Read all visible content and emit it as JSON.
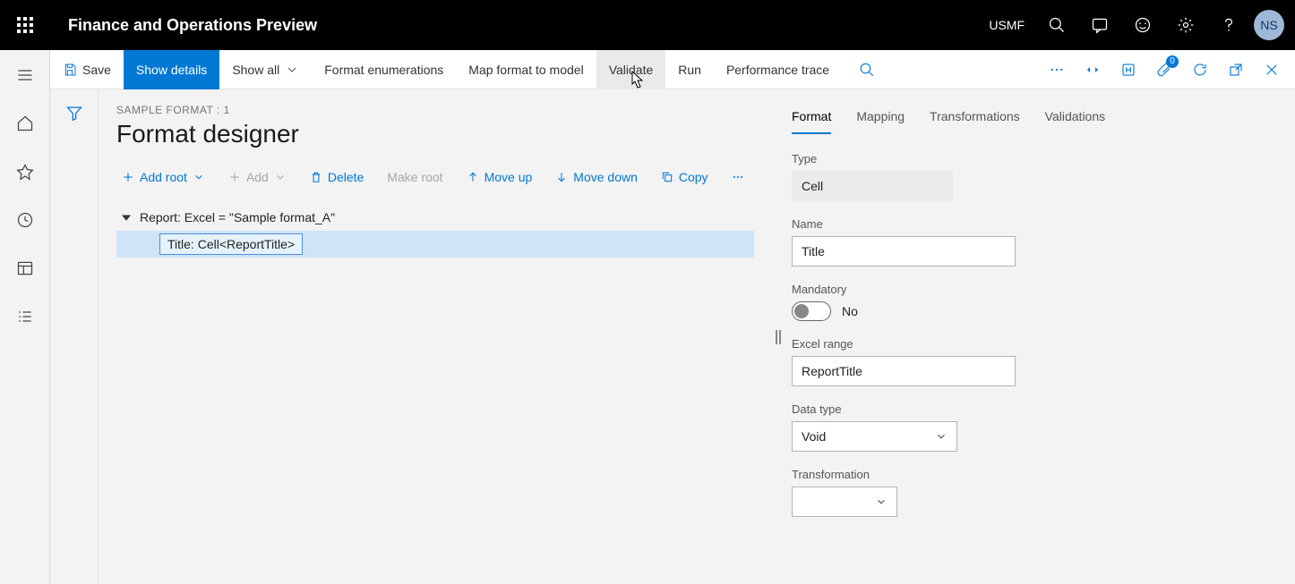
{
  "header": {
    "app_title": "Finance and Operations Preview",
    "company": "USMF",
    "avatar": "NS"
  },
  "commandBar": {
    "save": "Save",
    "show_details": "Show details",
    "show_all": "Show all",
    "format_enum": "Format enumerations",
    "map_format": "Map format to model",
    "validate": "Validate",
    "run": "Run",
    "perf_trace": "Performance trace",
    "attachments_badge": "0"
  },
  "page": {
    "breadcrumb": "SAMPLE FORMAT : 1",
    "title": "Format designer"
  },
  "treeToolbar": {
    "add_root": "Add root",
    "add": "Add",
    "delete": "Delete",
    "make_root": "Make root",
    "move_up": "Move up",
    "move_down": "Move down",
    "copy": "Copy"
  },
  "tree": {
    "root": "Report: Excel = \"Sample format_A\"",
    "child": "Title: Cell<ReportTitle>"
  },
  "tabs": {
    "format": "Format",
    "mapping": "Mapping",
    "transformations": "Transformations",
    "validations": "Validations"
  },
  "props": {
    "type_label": "Type",
    "type_value": "Cell",
    "name_label": "Name",
    "name_value": "Title",
    "mandatory_label": "Mandatory",
    "mandatory_value": "No",
    "excel_range_label": "Excel range",
    "excel_range_value": "ReportTitle",
    "data_type_label": "Data type",
    "data_type_value": "Void",
    "transformation_label": "Transformation",
    "transformation_value": ""
  }
}
